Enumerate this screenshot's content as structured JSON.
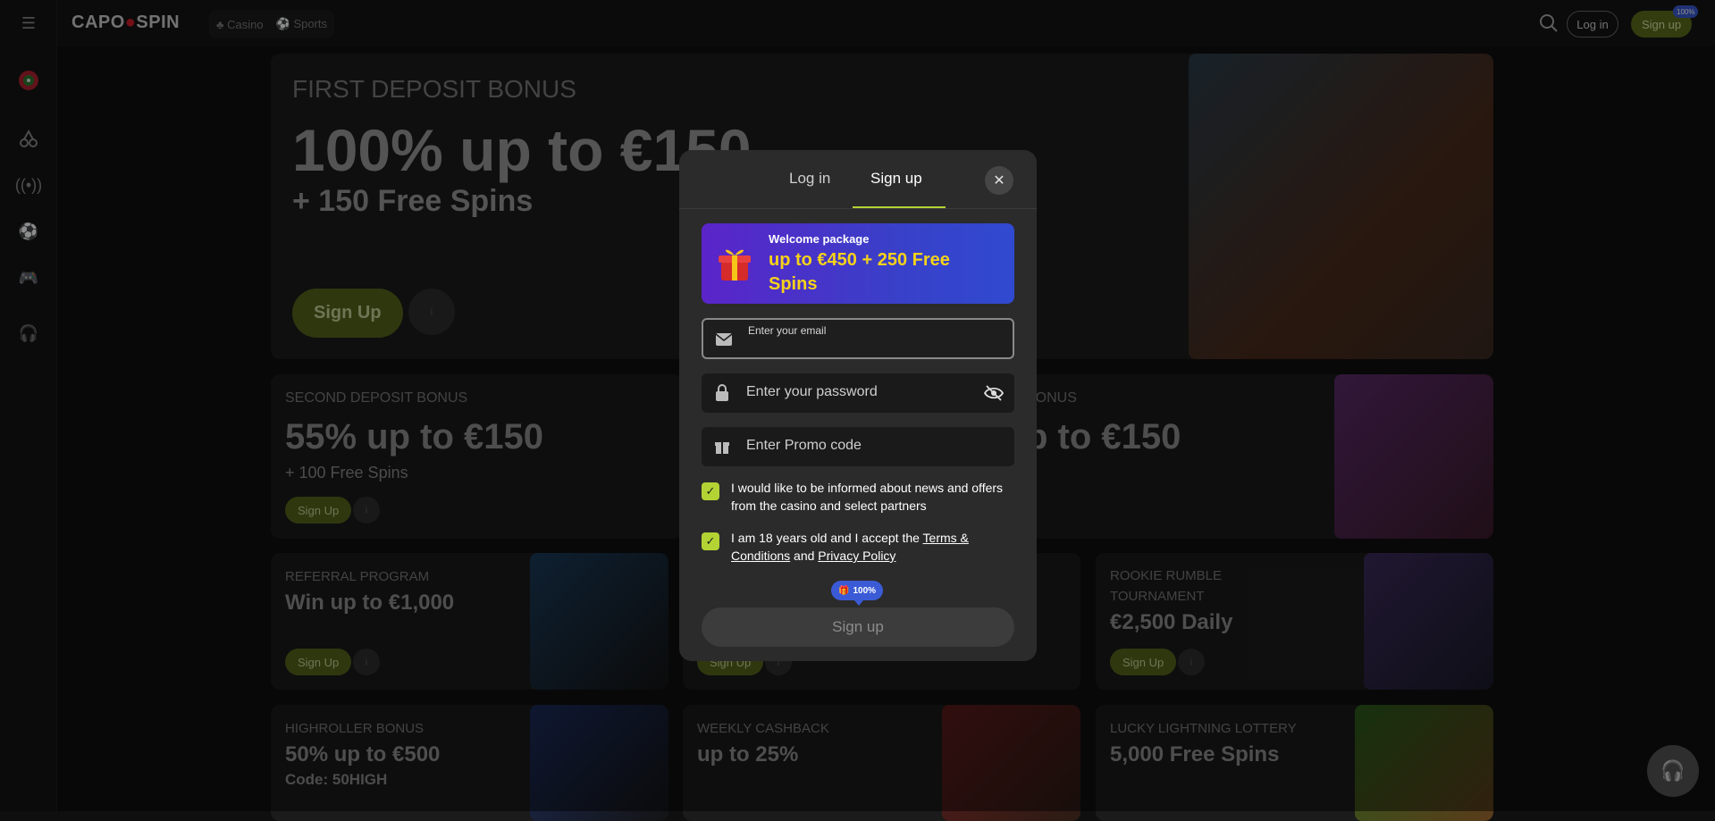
{
  "header": {
    "logo_left": "CAPO",
    "logo_right": "SPIN",
    "nav_casino": "Casino",
    "nav_sports": "Sports",
    "login_label": "Log in",
    "signup_label": "Sign up",
    "signup_badge": "100%"
  },
  "hero": {
    "title": "FIRST DEPOSIT BONUS",
    "headline": "100% up to €150",
    "subline": "+ 150 Free Spins",
    "button_label": "Sign Up"
  },
  "cards": [
    {
      "title": "SECOND DEPOSIT BONUS",
      "headline": "55% up to €150",
      "sub": "+ 100 Free Spins",
      "button": "Sign Up"
    },
    {
      "title": "BONUS",
      "headline": "p to €150",
      "sub": "",
      "button": ""
    },
    {
      "title": "REFERRAL PROGRAM",
      "headline": "Win up to €1,000",
      "sub": "",
      "button": "Sign Up"
    },
    {
      "title": "",
      "headline": "",
      "sub": "",
      "button": "Sign Up"
    },
    {
      "title": "ROOKIE RUMBLE TOURNAMENT",
      "headline": "€2,500 Daily",
      "sub": "",
      "button": "Sign Up"
    },
    {
      "title": "HIGHROLLER BONUS",
      "headline": "50% up to €500",
      "sub": "Code: 50HIGH",
      "button": ""
    },
    {
      "title": "WEEKLY CASHBACK",
      "headline": "up to 25%",
      "sub": "",
      "button": ""
    },
    {
      "title": "LUCKY LIGHTNING LOTTERY",
      "headline": "5,000 Free Spins",
      "sub": "",
      "button": ""
    }
  ],
  "modal": {
    "tab_login": "Log in",
    "tab_signup": "Sign up",
    "welcome_label": "Welcome package",
    "welcome_value": "up to €450 + 250 Free Spins",
    "email_placeholder": "Enter your email",
    "password_placeholder": "Enter your password",
    "promo_placeholder": "Enter Promo code",
    "consent_news": "I would like to be informed about news and offers from the casino and select partners",
    "consent_age_prefix": "I am 18 years old and I accept the ",
    "terms_link": "Terms & Conditions",
    "consent_and": " and ",
    "privacy_link": "Privacy Policy",
    "badge": "100%",
    "submit_label": "Sign up"
  },
  "colors": {
    "accent": "#b3d334",
    "button_green": "#56651d",
    "badge_blue": "#3b5bd6",
    "welcome_gradient_start": "#5a24c9",
    "welcome_value": "#f5d21a"
  }
}
